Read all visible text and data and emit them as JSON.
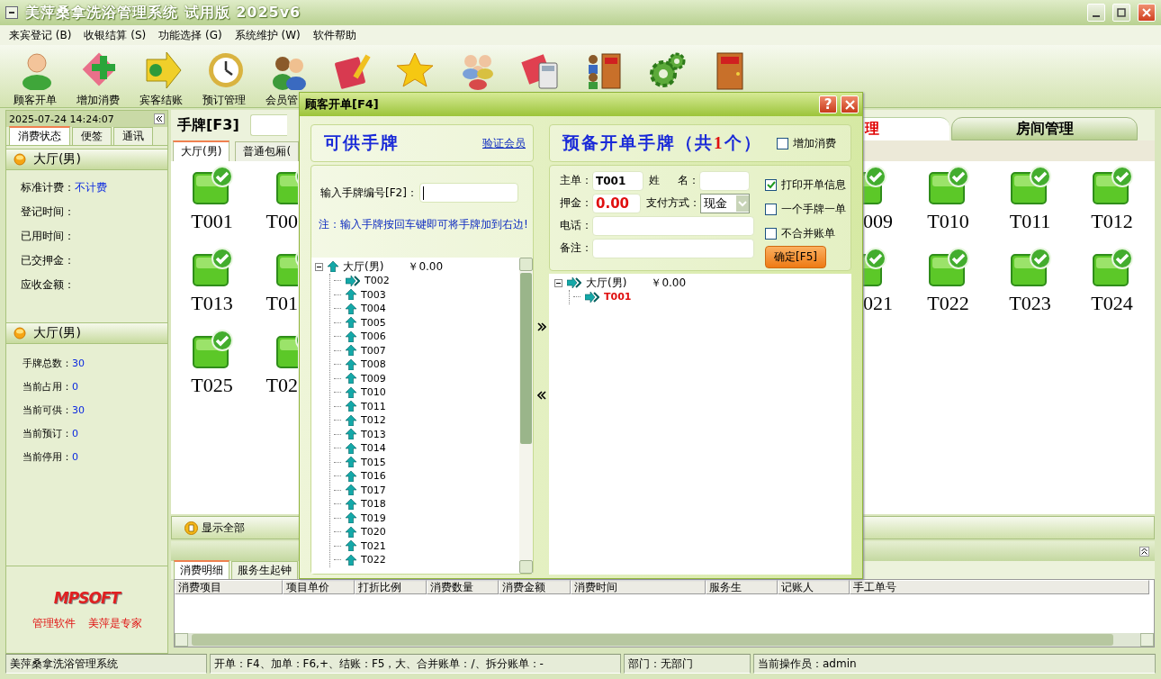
{
  "window": {
    "title": "美萍桑拿洗浴管理系统 试用版 2025v6"
  },
  "menu": [
    "来宾登记 (B)",
    "收银结算 (S)",
    "功能选择 (G)",
    "系统维护 (W)",
    "软件帮助"
  ],
  "toolbar_labels": [
    "顾客开单",
    "增加消费",
    "宾客结账",
    "预订管理",
    "会员管"
  ],
  "left_panel": {
    "clock": "2025-07-24 14:24:07",
    "tabs": [
      {
        "label": "消费状态",
        "selected": true
      },
      {
        "label": "便签",
        "selected": false
      },
      {
        "label": "通讯",
        "selected": false
      }
    ],
    "status_section": {
      "title": "大厅(男)",
      "fields": [
        {
          "label": "标准计费：",
          "value": "不计费"
        },
        {
          "label": "登记时间："
        },
        {
          "label": "已用时间："
        },
        {
          "label": "已交押金："
        },
        {
          "label": "应收金额："
        }
      ]
    },
    "stats_section": {
      "title": "大厅(男)",
      "fields": [
        {
          "label": "手牌总数：",
          "value": "30"
        },
        {
          "label": "当前占用：",
          "value": "0"
        },
        {
          "label": "当前可供：",
          "value": "30"
        },
        {
          "label": "当前预订：",
          "value": "0"
        },
        {
          "label": "当前停用：",
          "value": "0"
        }
      ]
    },
    "logo": "MPSOFT",
    "slogan": [
      "管理软件",
      "美萍是专家"
    ]
  },
  "main": {
    "header": "手牌[F3]",
    "top_tabs": [
      {
        "label": "理",
        "selected": true
      },
      {
        "label": "房间管理",
        "selected": false
      }
    ],
    "sub_tabs": [
      {
        "label": "大厅(男)",
        "selected": true
      },
      {
        "label": "普通包厢(",
        "selected": false
      }
    ],
    "left_tiles": [
      [
        "T001",
        "T00"
      ],
      [
        "T013",
        "T01"
      ],
      [
        "T025",
        "T02"
      ]
    ],
    "right_tiles": [
      [
        "009",
        "T010",
        "T011",
        "T012"
      ],
      [
        "021",
        "T022",
        "T023",
        "T024"
      ]
    ],
    "show_all": "显示全部",
    "detail_tabs": [
      {
        "label": "消费明细",
        "selected": true
      },
      {
        "label": "服务生起钟",
        "selected": false
      }
    ],
    "detail_columns": [
      "消费项目",
      "项目单价",
      "打折比例",
      "消费数量",
      "消费金额",
      "消费时间",
      "服务生",
      "记账人",
      "手工单号"
    ]
  },
  "dialog": {
    "title": "顾客开单[F4]",
    "help": "?",
    "available": {
      "title": "可供手牌",
      "link": "验证会员",
      "input_label": "输入手牌编号[F2]：",
      "note": "注：输入手牌按回车键即可将手牌加到右边!",
      "tree": {
        "label": "大厅(男)",
        "amount": "￥0.00",
        "kind": "free",
        "expanded": true,
        "children": [
          {
            "label": "T002",
            "kind": "moved"
          },
          {
            "label": "T003",
            "kind": "free"
          },
          {
            "label": "T004",
            "kind": "free"
          },
          {
            "label": "T005",
            "kind": "free"
          },
          {
            "label": "T006",
            "kind": "free"
          },
          {
            "label": "T007",
            "kind": "free"
          },
          {
            "label": "T008",
            "kind": "free"
          },
          {
            "label": "T009",
            "kind": "free"
          },
          {
            "label": "T010",
            "kind": "free"
          },
          {
            "label": "T011",
            "kind": "free"
          },
          {
            "label": "T012",
            "kind": "free"
          },
          {
            "label": "T013",
            "kind": "free"
          },
          {
            "label": "T014",
            "kind": "free"
          },
          {
            "label": "T015",
            "kind": "free"
          },
          {
            "label": "T016",
            "kind": "free"
          },
          {
            "label": "T017",
            "kind": "free"
          },
          {
            "label": "T018",
            "kind": "free"
          },
          {
            "label": "T019",
            "kind": "free"
          },
          {
            "label": "T020",
            "kind": "free"
          },
          {
            "label": "T021",
            "kind": "free"
          },
          {
            "label": "T022",
            "kind": "free"
          }
        ]
      }
    },
    "pending": {
      "title_before": "预备开单手牌（共",
      "count": "1",
      "title_after": "个）",
      "add_consumption": {
        "label": "增加消费",
        "checked": false
      },
      "main_label": "主单：",
      "main_value": "T001",
      "name_label_1": "姓",
      "name_label_2": "名：",
      "deposit_label": "押金：",
      "deposit_value": "0.00",
      "payment_label": "支付方式：",
      "payment_value": "现金",
      "phone_label": "电话：",
      "remark_label": "备注：",
      "options": [
        {
          "label": "打印开单信息",
          "checked": true
        },
        {
          "label": "一个手牌一单",
          "checked": false
        },
        {
          "label": "不合并账单",
          "checked": false
        }
      ],
      "confirm": "确定[F5]",
      "tree": {
        "label": "大厅(男)",
        "amount": "￥0.00",
        "kind": "moved",
        "expanded": true,
        "children": [
          {
            "label": "T001",
            "kind": "moved",
            "selected": true
          }
        ]
      }
    }
  },
  "status_bar": [
    "美萍桑拿洗浴管理系统",
    "开单：F4、加单：F6,+、结账：F5，大、合并账单：/、拆分账单：-",
    "部门：无部门",
    "当前操作员：admin"
  ]
}
